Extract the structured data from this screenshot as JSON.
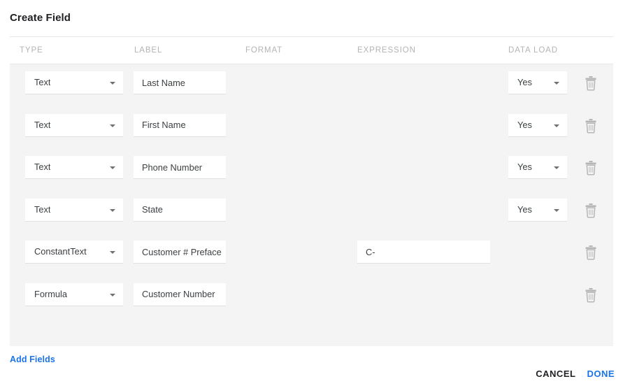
{
  "dialog": {
    "title": "Create Field"
  },
  "table": {
    "columns": [
      {
        "key": "type",
        "label": "TYPE"
      },
      {
        "key": "label",
        "label": "LABEL"
      },
      {
        "key": "format",
        "label": "FORMAT"
      },
      {
        "key": "expression",
        "label": "EXPRESSION"
      },
      {
        "key": "dataload",
        "label": "DATA LOAD"
      }
    ],
    "rows": [
      {
        "type": "Text",
        "label": "Last Name",
        "format": "",
        "expression": "",
        "data_load": "Yes",
        "has_data_load": true,
        "delete_icon": "trash-icon"
      },
      {
        "type": "Text",
        "label": "First Name",
        "format": "",
        "expression": "",
        "data_load": "Yes",
        "has_data_load": true,
        "delete_icon": "trash-icon"
      },
      {
        "type": "Text",
        "label": "Phone Number",
        "format": "",
        "expression": "",
        "data_load": "Yes",
        "has_data_load": true,
        "delete_icon": "trash-icon"
      },
      {
        "type": "Text",
        "label": "State",
        "format": "",
        "expression": "",
        "data_load": "Yes",
        "has_data_load": true,
        "delete_icon": "trash-icon"
      },
      {
        "type": "ConstantText",
        "label": "Customer # Preface",
        "format": "",
        "expression": "C-",
        "data_load": "",
        "has_data_load": false,
        "delete_icon": "trash-icon"
      },
      {
        "type": "Formula",
        "label": "Customer Number",
        "format": "",
        "expression": "",
        "data_load": "",
        "has_data_load": false,
        "delete_icon": "trash-icon"
      }
    ]
  },
  "footer": {
    "add_fields_label": "Add Fields",
    "cancel_label": "CANCEL",
    "done_label": "DONE"
  },
  "colors": {
    "accent_blue": "#1a73e8",
    "panel_gray": "#f4f4f4",
    "header_text": "#b4b4b4",
    "rule": "#e6e6e6"
  }
}
